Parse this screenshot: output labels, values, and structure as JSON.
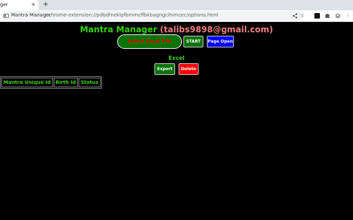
{
  "browser": {
    "tab": {
      "title": "ger",
      "close": "×"
    },
    "new_tab": "+",
    "address_bar": {
      "site_name": "Mantra Manager",
      "separator": "|",
      "url": "chrome-extension://pdbdfneklpfbmmcffbkbagngcihimcec/options.html"
    },
    "icons": [
      "share-icon",
      "bookmark-star-icon",
      "sidebar-icon",
      "extensions-puzzle-icon",
      "profile-icon",
      "more-menu-icon"
    ]
  },
  "page": {
    "app_name": "Mantra Manager",
    "email": "(talibs9898@gmail.com)",
    "select_excel_label": "Select Excel File",
    "start_label": "START",
    "page_open_label": "Page Open",
    "excel_label": "Excel",
    "export_label": "Export",
    "delete_label": "Delete",
    "table": {
      "headers": [
        "Mantra Unique Id",
        "Birth Id",
        "Status"
      ]
    }
  },
  "colors": {
    "background": "#000000",
    "accent_green": "#39d400",
    "button_green": "#087308",
    "button_blue": "#0000ff",
    "button_red": "#ff0000",
    "email_color": "#f08080"
  }
}
